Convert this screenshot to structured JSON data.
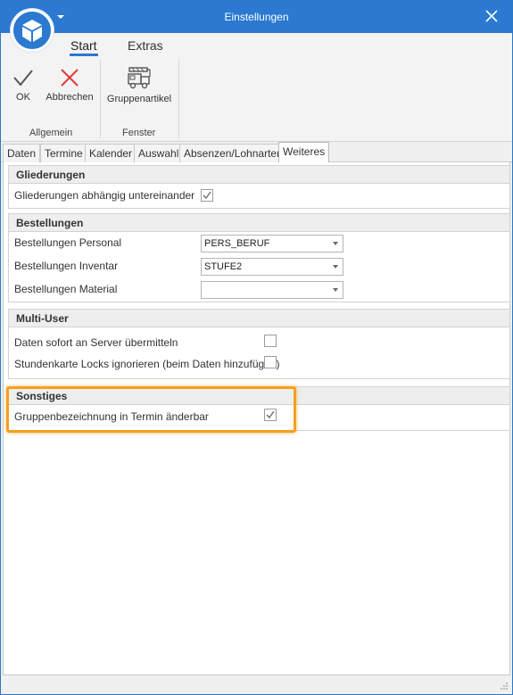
{
  "window": {
    "title": "Einstellungen"
  },
  "ribbon": {
    "tabs": [
      {
        "label": "Start"
      },
      {
        "label": "Extras"
      }
    ],
    "buttons": {
      "ok": "OK",
      "cancel": "Abbrechen",
      "group_articles": "Gruppenartikel"
    },
    "groups": {
      "general": "Allgemein",
      "window": "Fenster"
    }
  },
  "tabs": [
    {
      "label": "Daten"
    },
    {
      "label": "Termine"
    },
    {
      "label": "Kalender"
    },
    {
      "label": "Auswahl"
    },
    {
      "label": "Absenzen/Lohnarten"
    },
    {
      "label": "Weiteres"
    }
  ],
  "sections": {
    "gliederungen": {
      "title": "Gliederungen",
      "rows": [
        {
          "label": "Gliederungen abhängig untereinander",
          "checked": true
        }
      ]
    },
    "bestellungen": {
      "title": "Bestellungen",
      "rows": [
        {
          "label": "Bestellungen Personal",
          "value": "PERS_BERUF"
        },
        {
          "label": "Bestellungen Inventar",
          "value": "STUFE2"
        },
        {
          "label": "Bestellungen Material",
          "value": ""
        }
      ]
    },
    "multi_user": {
      "title": "Multi-User",
      "rows": [
        {
          "label": "Daten sofort an Server übermitteln",
          "checked": false
        },
        {
          "label": "Stundenkarte Locks ignorieren (beim Daten hinzufügen)",
          "checked": false
        }
      ]
    },
    "sonstiges": {
      "title": "Sonstiges",
      "rows": [
        {
          "label": "Gruppenbezeichnung in Termin änderbar",
          "checked": true
        }
      ]
    }
  },
  "colors": {
    "titlebar": "#2b79d0",
    "highlight": "#f4a020",
    "cancel_icon": "#e03c3c"
  }
}
